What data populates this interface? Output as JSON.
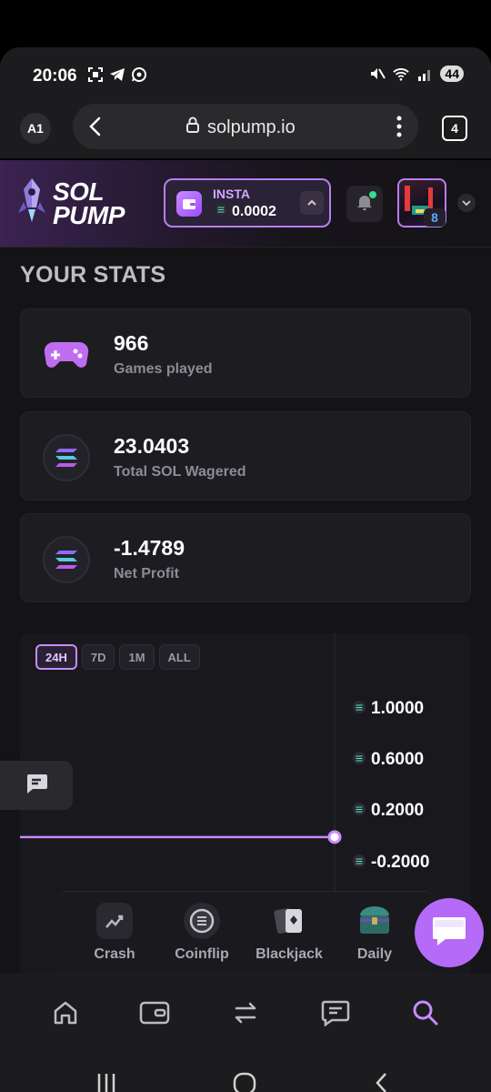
{
  "status_bar": {
    "time": "20:06",
    "battery": "44",
    "left_icons": [
      "screenshot-icon",
      "telegram-icon",
      "whatsapp-icon"
    ],
    "right_icons": [
      "mute-icon",
      "wifi-icon",
      "signal-icon"
    ]
  },
  "browser": {
    "account_label": "A1",
    "url": "solpump.io",
    "tab_count": "4"
  },
  "site_header": {
    "logo_line1": "SOL",
    "logo_line2": "PUMP",
    "wallet_label": "INSTA",
    "wallet_balance": "0.0002",
    "level": "8"
  },
  "stats": {
    "title": "YOUR STATS",
    "cards": [
      {
        "value": "966",
        "label": "Games played",
        "icon": "gamepad-icon"
      },
      {
        "value": "23.0403",
        "label": "Total SOL Wagered",
        "icon": "solana-icon"
      },
      {
        "value": "-1.4789",
        "label": "Net Profit",
        "icon": "solana-icon"
      }
    ]
  },
  "chart": {
    "range_tabs": [
      "24H",
      "7D",
      "1M",
      "ALL"
    ],
    "active_range": "24H",
    "y_labels": [
      "1.0000",
      "0.6000",
      "0.2000",
      "-0.2000"
    ]
  },
  "chart_data": {
    "type": "line",
    "title": "",
    "xlabel": "",
    "ylabel": "",
    "y_ticks": [
      1.0,
      0.6,
      0.2,
      -0.2
    ],
    "ylim": [
      -0.2,
      1.0
    ],
    "series": [
      {
        "values": [
          0,
          0
        ]
      }
    ],
    "line_color": "#c98bff",
    "grid": false
  },
  "games": [
    {
      "label": "Crash",
      "icon": "chart-line-icon"
    },
    {
      "label": "Coinflip",
      "icon": "coin-icon"
    },
    {
      "label": "Blackjack",
      "icon": "cards-icon"
    },
    {
      "label": "Daily",
      "icon": "chest-icon"
    }
  ],
  "bottom_nav": [
    {
      "name": "home-icon"
    },
    {
      "name": "wallet-icon"
    },
    {
      "name": "swap-icon"
    },
    {
      "name": "chat-icon"
    },
    {
      "name": "search-icon"
    }
  ],
  "colors": {
    "accent": "#b56af8",
    "accent_light": "#c98bff",
    "card_bg": "#1d1c21",
    "page_bg": "#141316",
    "solana_green": "#35e08e"
  }
}
